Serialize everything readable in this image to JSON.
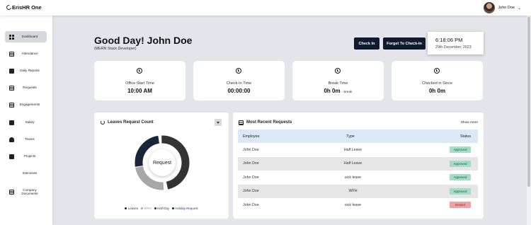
{
  "app": {
    "logo": "ErisHR One"
  },
  "user": {
    "name": "John Doe"
  },
  "sidebar": {
    "items": [
      {
        "label": "Dashboard",
        "icon": "grid-icon"
      },
      {
        "label": "Attendance",
        "icon": "calendar-icon"
      },
      {
        "label": "Daily Reports",
        "icon": "chart-icon"
      },
      {
        "label": "Requests",
        "icon": "document-icon"
      },
      {
        "label": "Engagements",
        "icon": "calendar-icon"
      },
      {
        "label": "Salary",
        "icon": "wallet-icon"
      },
      {
        "label": "Teams",
        "icon": "people-icon"
      },
      {
        "label": "Projects",
        "icon": "briefcase-icon"
      },
      {
        "label": "Interviews",
        "icon": ""
      },
      {
        "label": "Company Documents",
        "icon": "list-icon"
      }
    ]
  },
  "header": {
    "greeting": "Good Day! John Doe",
    "role": "(MERN Stack Developer)",
    "check_in_label": "Check In",
    "forgot_label": "Forget To Check-In",
    "clock_time": "6:18:06 PM",
    "clock_date": "29th December, 2023"
  },
  "stats": [
    {
      "label": "Office Start Time",
      "value": "10:00 AM",
      "suffix": ""
    },
    {
      "label": "Check-In Time",
      "value": "00:00:00",
      "suffix": ""
    },
    {
      "label": "Break Time",
      "value": "0h 0m",
      "suffix": "- break"
    },
    {
      "label": "Checked in Since",
      "value": "0h 0m",
      "suffix": ""
    }
  ],
  "leaves": {
    "title": "Leaves Request Count",
    "center_label": "Request",
    "legend": [
      "Leaves",
      "WFH",
      "Half Day",
      "Holiday Request"
    ],
    "colors": {
      "leaves": "#1a2438",
      "wfh": "#a7a7a7",
      "half_day": "#333333",
      "holiday": "#1a2438"
    }
  },
  "requests": {
    "title": "Most Recent Requests",
    "show_more": "Show more",
    "headers": [
      "Employee",
      "Type",
      "Status"
    ],
    "rows": [
      {
        "employee": "John Doe",
        "type": "Half Leave",
        "status": "Approved"
      },
      {
        "employee": "John Doe",
        "type": "Half Leave",
        "status": "Approved"
      },
      {
        "employee": "John Doe",
        "type": "sick leave",
        "status": "Approved"
      },
      {
        "employee": "John Doe",
        "type": "WFH",
        "status": "Approved"
      },
      {
        "employee": "John Doe",
        "type": "sick leave",
        "status": "Denied"
      }
    ]
  }
}
